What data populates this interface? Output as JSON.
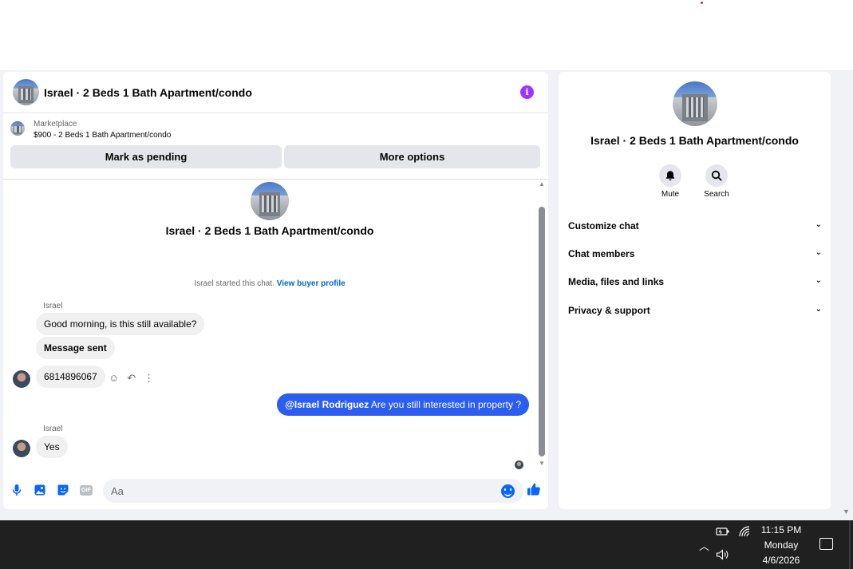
{
  "conversation": {
    "title": "Israel · 2 Beds 1 Bath Apartment/condo"
  },
  "marketplace": {
    "label": "Marketplace",
    "item": "$900 - 2 Beds 1 Bath Apartment/condo",
    "mark_pending_label": "Mark as pending",
    "more_options_label": "More options"
  },
  "thread": {
    "intro_title": "Israel · 2 Beds 1 Bath Apartment/condo",
    "started_text": "Israel started this chat.",
    "view_profile_label": "View buyer profile",
    "messages": [
      {
        "sender": "Israel",
        "text": "Good morning, is this still available?"
      },
      {
        "text": "Message sent"
      },
      {
        "text": "6814896067"
      },
      {
        "mention": "@Israel Rodriguez",
        "text": "Are you still interested in property ?"
      },
      {
        "sender": "Israel",
        "text": "Yes"
      }
    ]
  },
  "composer": {
    "placeholder": "Aa",
    "gif_label": "GIF"
  },
  "info_panel": {
    "title": "Israel · 2 Beds 1 Bath Apartment/condo",
    "mute_label": "Mute",
    "search_label": "Search",
    "sections": [
      "Customize chat",
      "Chat members",
      "Media, files and links",
      "Privacy & support"
    ]
  },
  "taskbar": {
    "time": "11:15 PM",
    "day": "Monday",
    "date": "4/6/2026"
  },
  "colors": {
    "accent": "#0866ff",
    "outgoing_bubble": "#2b5ef0",
    "info_icon": "#a033ff",
    "taskbar": "#202020"
  },
  "icons": {
    "info": "info-icon",
    "mute": "bell-icon",
    "search": "search-icon",
    "mic": "microphone-icon",
    "image": "image-icon",
    "sticker": "sticker-icon",
    "emoji": "emoji-icon",
    "like": "thumbs-up-icon"
  }
}
